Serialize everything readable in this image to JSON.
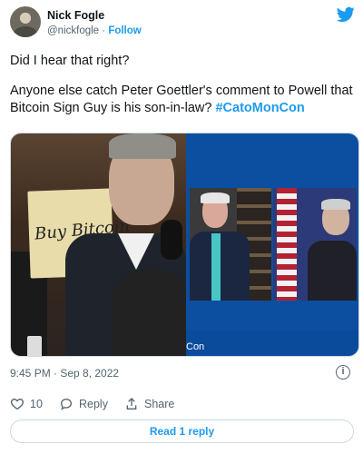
{
  "user": {
    "name": "Nick Fogle",
    "handle": "@nickfogle",
    "separator": "·",
    "follow_label": "Follow"
  },
  "tweet": {
    "line1": "Did I hear that right?",
    "line2": "Anyone else catch Peter Goettler's comment to Powell that Bitcoin Sign Guy is his son-in-law?",
    "hashtag": "#CatoMonCon"
  },
  "media": {
    "sign_text": "Buy Bitcoin",
    "caption_fragment": "Con"
  },
  "meta": {
    "timestamp": "9:45 PM · Sep 8, 2022",
    "info_glyph": "i"
  },
  "actions": {
    "like_count": "10",
    "reply_label": "Reply",
    "share_label": "Share"
  },
  "read_replies_label": "Read 1 reply",
  "colors": {
    "accent": "#1d9bf0",
    "text": "#0f1419",
    "muted": "#536471"
  },
  "icons": [
    "twitter-bird-icon",
    "heart-icon",
    "reply-bubble-icon",
    "share-icon",
    "info-icon"
  ]
}
